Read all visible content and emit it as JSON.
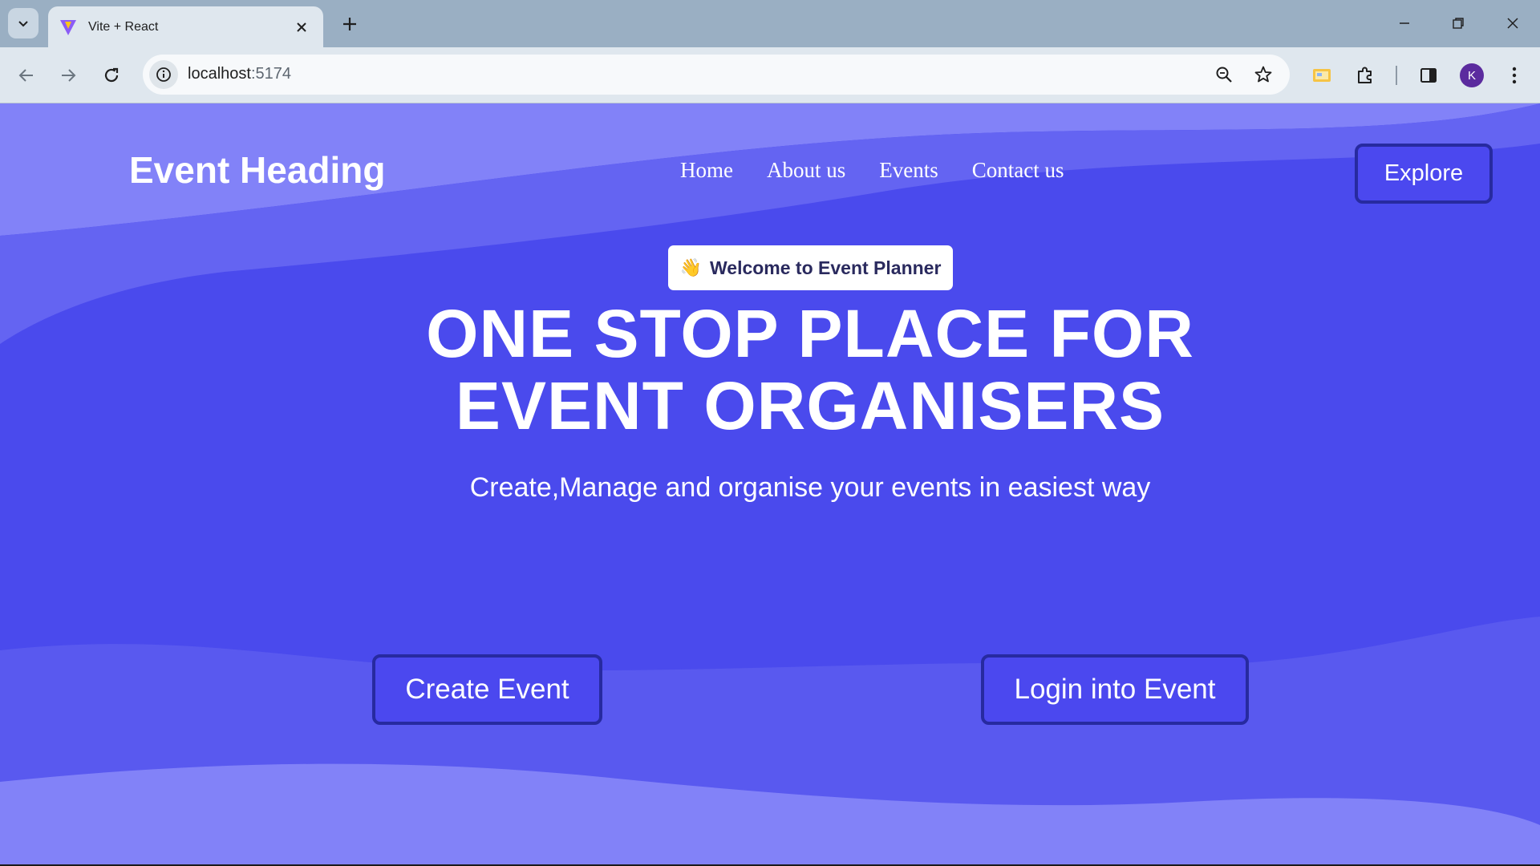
{
  "browser": {
    "tab": {
      "title": "Vite + React"
    },
    "address": {
      "host": "localhost",
      "port": ":5174"
    },
    "profile_initial": "K"
  },
  "page": {
    "brand": "Event Heading",
    "nav": [
      "Home",
      "About us",
      "Events",
      "Contact us"
    ],
    "explore_label": "Explore",
    "welcome_badge": "Welcome to Event Planner",
    "welcome_emoji": "👋",
    "headline_line1": "ONE STOP PLACE FOR",
    "headline_line2": "EVENT ORGANISERS",
    "subheadline": "Create,Manage and organise your events in easiest way",
    "create_label": "Create Event",
    "login_label": "Login into Event"
  },
  "colors": {
    "page_bg": "#4a4aed",
    "wave_light": "#8282f8",
    "wave_mid": "#6464f2",
    "button_border": "#272aa0",
    "badge_text": "#2a2a5e"
  }
}
